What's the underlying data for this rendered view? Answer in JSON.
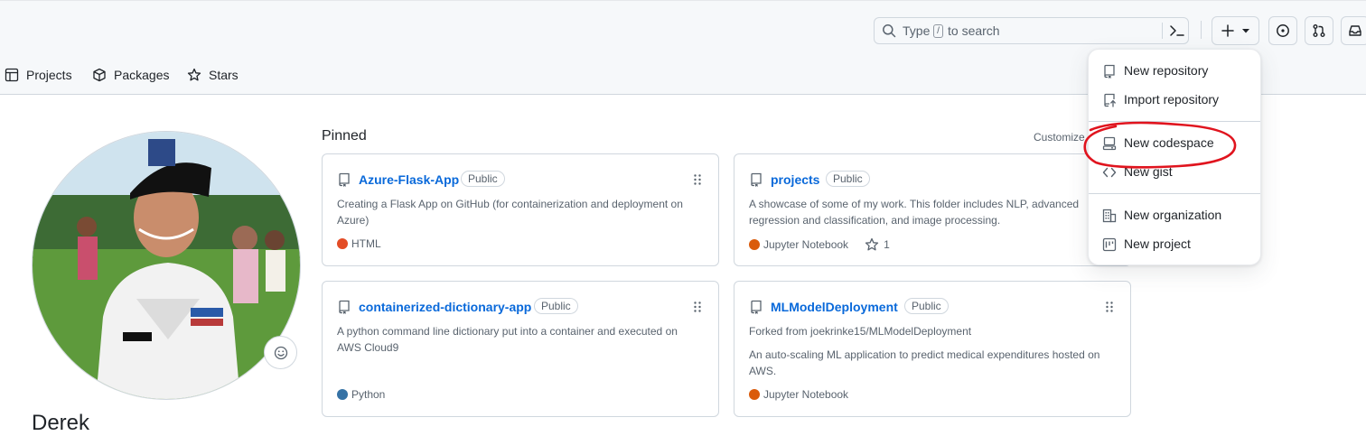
{
  "header": {
    "search": {
      "before_key": "Type",
      "key": "/",
      "after_key": "to search"
    }
  },
  "nav": {
    "items": [
      {
        "label": "Projects",
        "icon": "table-icon"
      },
      {
        "label": "Packages",
        "icon": "package-icon"
      },
      {
        "label": "Stars",
        "icon": "star-icon"
      }
    ]
  },
  "profile": {
    "name": "Derek"
  },
  "pinned": {
    "title": "Pinned",
    "customize_label": "Customize",
    "repos": [
      {
        "name": "Azure-Flask-App",
        "visibility": "Public",
        "description": "Creating a Flask App on GitHub (for containerization and deployment on Azure)",
        "language": "HTML",
        "language_color": "#e34c26"
      },
      {
        "name": "projects",
        "visibility": "Public",
        "description": "A showcase of some of my work. This folder includes NLP, advanced regression and classification, and image processing.",
        "language": "Jupyter Notebook",
        "language_color": "#da5b0b",
        "stars": "1"
      },
      {
        "name": "containerized-dictionary-app",
        "visibility": "Public",
        "description": "A python command line dictionary put into a container and executed on AWS Cloud9",
        "language": "Python",
        "language_color": "#3572a5"
      },
      {
        "name": "MLModelDeployment",
        "visibility": "Public",
        "forked_from": "Forked from joekrinke15/MLModelDeployment",
        "description": "An auto-scaling ML application to predict medical expenditures hosted on AWS.",
        "language": "Jupyter Notebook",
        "language_color": "#da5b0b"
      }
    ]
  },
  "create_menu": {
    "items": [
      {
        "label": "New repository",
        "icon": "repo-icon"
      },
      {
        "label": "Import repository",
        "icon": "repo-push-icon"
      },
      {
        "label": "New codespace",
        "icon": "codespaces-icon"
      },
      {
        "label": "New gist",
        "icon": "code-icon"
      },
      {
        "label": "New organization",
        "icon": "organization-icon"
      },
      {
        "label": "New project",
        "icon": "project-icon"
      }
    ]
  },
  "colors": {
    "link": "#0969da",
    "muted": "#59636e",
    "border": "#d0d7de",
    "annotation": "#e0141e"
  }
}
